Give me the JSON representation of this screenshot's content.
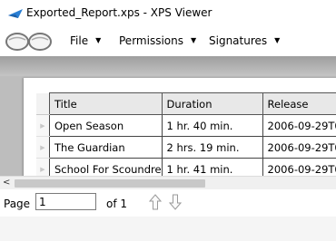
{
  "window": {
    "title": "Exported_Report.xps - XPS Viewer"
  },
  "menu": {
    "items": [
      {
        "label": "File",
        "arrow": "▼"
      },
      {
        "label": "Permissions",
        "arrow": "▼"
      },
      {
        "label": "Signatures",
        "arrow": "▼"
      }
    ]
  },
  "document": {
    "columns": [
      "Title",
      "Duration",
      "Release"
    ],
    "rows": [
      [
        "Open Season",
        "1 hr. 40 min.",
        "2006-09-29T0"
      ],
      [
        "The Guardian",
        "2 hrs. 19 min.",
        "2006-09-29T0"
      ],
      [
        "School For Scoundre",
        "1 hr. 41 min.",
        "2006-09-29T0"
      ]
    ],
    "row_marker": "▶"
  },
  "scrollbar": {
    "left_arrow": "<"
  },
  "status": {
    "page_label": "Page",
    "page_value": "1",
    "of_label": "of 1"
  },
  "icons": {
    "app": "xps-viewer-icon",
    "logo": "xps-logo-icon",
    "up": "arrow-up-icon",
    "down": "arrow-down-icon"
  }
}
